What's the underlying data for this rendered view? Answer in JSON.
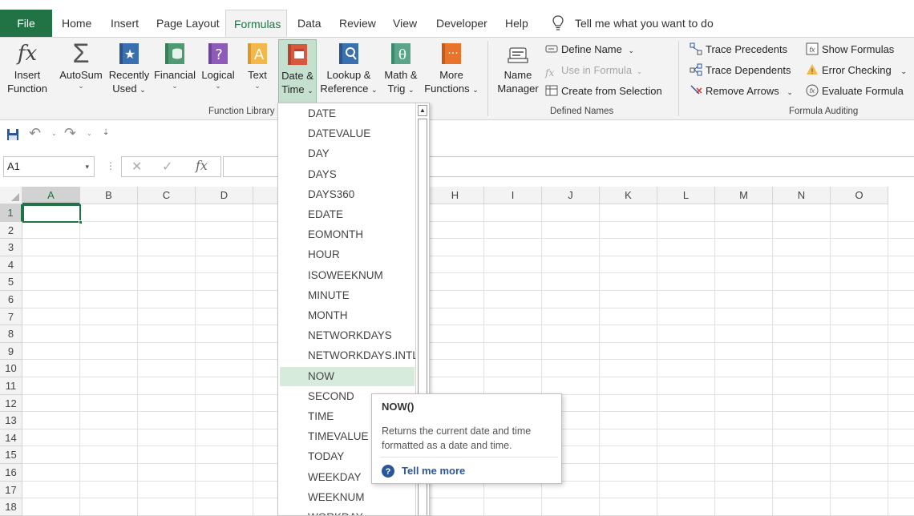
{
  "tabs": [
    "File",
    "Home",
    "Insert",
    "Page Layout",
    "Formulas",
    "Data",
    "Review",
    "View",
    "Developer",
    "Help"
  ],
  "tell_me": "Tell me what you want to do",
  "function_library": {
    "insert_function": [
      "Insert",
      "Function"
    ],
    "autosum": "AutoSum",
    "recently_used": [
      "Recently",
      "Used"
    ],
    "financial": "Financial",
    "logical": "Logical",
    "text": "Text",
    "date_time": [
      "Date &",
      "Time"
    ],
    "lookup_reference": [
      "Lookup &",
      "Reference"
    ],
    "math_trig": [
      "Math &",
      "Trig"
    ],
    "more_functions": [
      "More",
      "Functions"
    ],
    "label": "Function Library"
  },
  "defined_names": {
    "name_manager": [
      "Name",
      "Manager"
    ],
    "define_name": "Define Name",
    "use_in_formula": "Use in Formula",
    "create_from_selection": "Create from Selection",
    "label": "Defined Names"
  },
  "formula_auditing": {
    "trace_precedents": "Trace Precedents",
    "trace_dependents": "Trace Dependents",
    "remove_arrows": "Remove Arrows",
    "show_formulas": "Show Formulas",
    "error_checking": "Error Checking",
    "evaluate_formula": "Evaluate Formula",
    "label": "Formula Auditing"
  },
  "name_box": "A1",
  "columns": [
    "A",
    "B",
    "C",
    "D",
    "",
    "",
    "",
    "H",
    "I",
    "J",
    "K",
    "L",
    "M",
    "N",
    "O"
  ],
  "rows": [
    "1",
    "2",
    "3",
    "4",
    "5",
    "6",
    "7",
    "8",
    "9",
    "10",
    "11",
    "12",
    "13",
    "14",
    "15",
    "16",
    "17",
    "18"
  ],
  "date_time_functions": [
    "DATE",
    "DATEVALUE",
    "DAY",
    "DAYS",
    "DAYS360",
    "EDATE",
    "EOMONTH",
    "HOUR",
    "ISOWEEKNUM",
    "MINUTE",
    "MONTH",
    "NETWORKDAYS",
    "NETWORKDAYS.INTL",
    "NOW",
    "SECOND",
    "TIME",
    "TIMEVALUE",
    "TODAY",
    "WEEKDAY",
    "WEEKNUM",
    "WORKDAY"
  ],
  "selected_function": "NOW",
  "tooltip": {
    "title": "NOW()",
    "description": [
      "Returns the current date and time",
      "formatted as a date and time."
    ],
    "link": "Tell me more"
  },
  "colors": {
    "excel_green": "#217346",
    "selected_item": "#d7ebdc",
    "link_blue": "#2b579a"
  }
}
